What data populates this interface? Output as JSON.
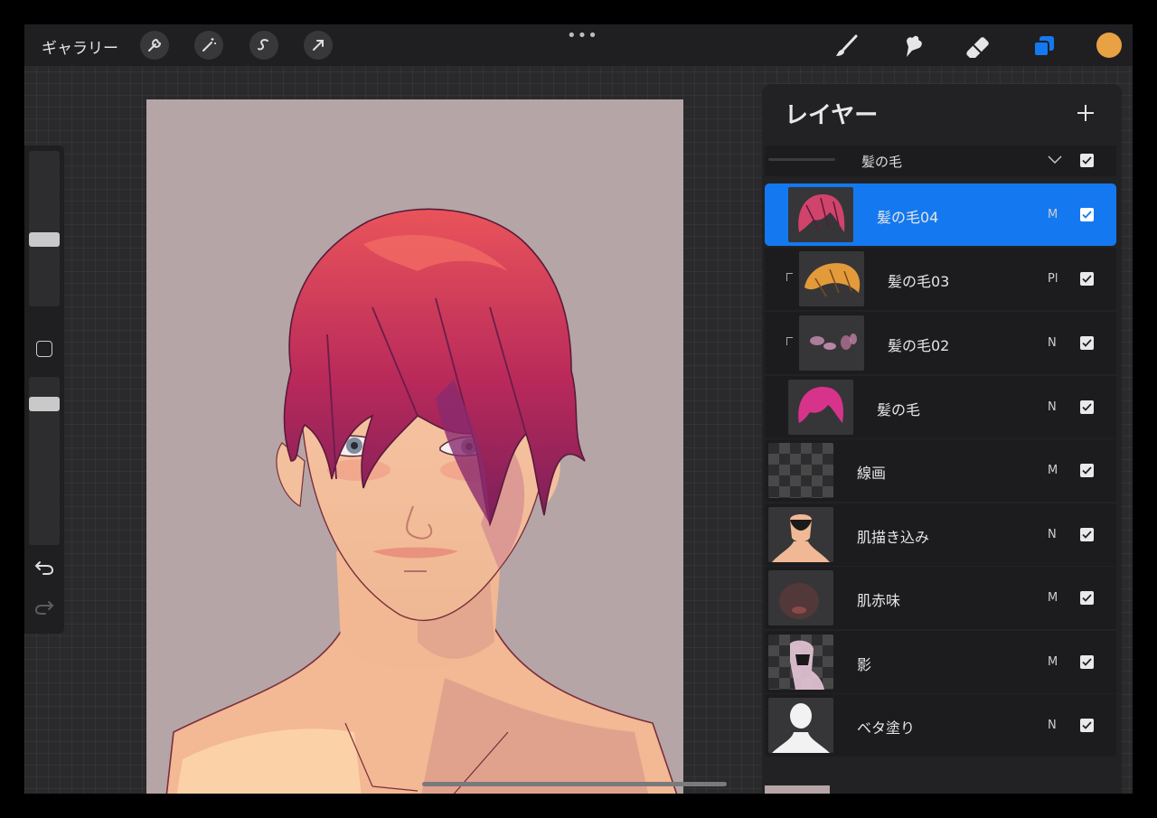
{
  "topbar": {
    "gallery_label": "ギャラリー",
    "left_tools": [
      "wrench-icon",
      "magic-wand-icon",
      "selection-s-icon",
      "transform-arrow-icon"
    ],
    "more": "•••",
    "right_tools": [
      "brush-icon",
      "smudge-icon",
      "eraser-icon",
      "layers-icon"
    ],
    "current_color": "#e9a243"
  },
  "sidebar": {
    "brush_size_level": 0.27,
    "opacity_level": 0.17
  },
  "layers_panel": {
    "title": "レイヤー",
    "group": {
      "name": "髪の毛",
      "expanded": true,
      "visible": true
    },
    "layers": [
      {
        "name": "髪の毛04",
        "mode": "M",
        "visible": true,
        "selected": true,
        "clipped": false
      },
      {
        "name": "髪の毛03",
        "mode": "Pl",
        "visible": true,
        "selected": false,
        "clipped": true
      },
      {
        "name": "髪の毛02",
        "mode": "N",
        "visible": true,
        "selected": false,
        "clipped": true
      },
      {
        "name": "髪の毛",
        "mode": "N",
        "visible": true,
        "selected": false,
        "clipped": false
      },
      {
        "name": "線画",
        "mode": "M",
        "visible": true,
        "selected": false,
        "clipped": false
      },
      {
        "name": "肌描き込み",
        "mode": "N",
        "visible": true,
        "selected": false,
        "clipped": false
      },
      {
        "name": "肌赤味",
        "mode": "M",
        "visible": true,
        "selected": false,
        "clipped": false
      },
      {
        "name": "影",
        "mode": "M",
        "visible": true,
        "selected": false,
        "clipped": false
      },
      {
        "name": "ベタ塗り",
        "mode": "N",
        "visible": true,
        "selected": false,
        "clipped": false
      }
    ]
  },
  "colors": {
    "accent": "#1479f0",
    "canvas_bg": "#b5a5a6"
  }
}
